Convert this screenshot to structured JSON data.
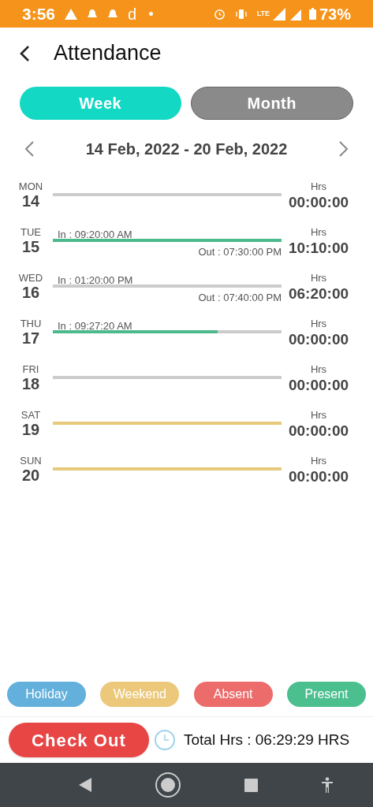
{
  "status_bar": {
    "time": "3:56",
    "app_letter": "d",
    "network": "LTE",
    "battery": "73%"
  },
  "header": {
    "title": "Attendance"
  },
  "tabs": [
    {
      "label": "Week",
      "selected": true
    },
    {
      "label": "Month",
      "selected": false
    }
  ],
  "date_range": "14 Feb, 2022 - 20 Feb, 2022",
  "days": [
    {
      "day": "MON",
      "date": "14",
      "hrs_label": "Hrs",
      "hrs": "00:00:00"
    },
    {
      "day": "TUE",
      "date": "15",
      "in": "In : 09:20:00 AM",
      "out": "Out : 07:30:00 PM",
      "hrs_label": "Hrs",
      "hrs": "10:10:00",
      "level": 1,
      "color": "#4cb98d"
    },
    {
      "day": "WED",
      "date": "16",
      "in": "In : 01:20:00 PM",
      "out": "Out : 07:40:00 PM",
      "hrs_label": "Hrs",
      "hrs": "06:20:00"
    },
    {
      "day": "THU",
      "date": "17",
      "in": "In : 09:27:20 AM",
      "hrs_label": "Hrs",
      "hrs": "00:00:00",
      "level": 0.72,
      "color": "#4cb98d"
    },
    {
      "day": "FRI",
      "date": "18",
      "hrs_label": "Hrs",
      "hrs": "00:00:00"
    },
    {
      "day": "SAT",
      "date": "19",
      "hrs_label": "Hrs",
      "hrs": "00:00:00",
      "level": 1,
      "color": "#e6c97a"
    },
    {
      "day": "SUN",
      "date": "20",
      "hrs_label": "Hrs",
      "hrs": "00:00:00",
      "level": 1,
      "color": "#e6c97a"
    }
  ],
  "legend": [
    {
      "label": "Holiday",
      "color": "#64b0dc"
    },
    {
      "label": "Weekend",
      "color": "#ecc97a"
    },
    {
      "label": "Absent",
      "color": "#ec6c6c"
    },
    {
      "label": "Present",
      "color": "#4cbf8f"
    }
  ],
  "footer": {
    "button": "Check Out",
    "total": "Total Hrs : 06:29:29 HRS"
  }
}
